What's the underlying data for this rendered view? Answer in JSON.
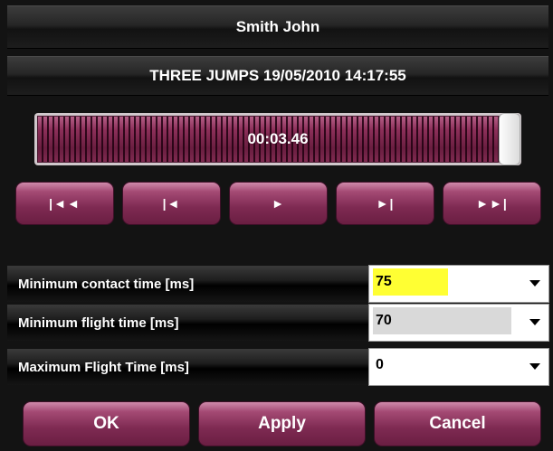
{
  "header": {
    "athlete_name": "Smith John"
  },
  "session": {
    "title": "THREE JUMPS 19/05/2010 14:17:55"
  },
  "timeline": {
    "current_time": "00:03.46",
    "progress": 1.0
  },
  "transport": {
    "first_label": "|◄◄",
    "prev_label": "|◄",
    "play_label": "►",
    "next_label": "►|",
    "last_label": "►►|"
  },
  "settings": {
    "min_contact": {
      "label": "Minimum contact time [ms]",
      "value": "75",
      "highlight": "#ffff33"
    },
    "min_flight": {
      "label": "Minimum flight time [ms]",
      "value": "70",
      "highlight": "#d9d9d9"
    },
    "max_flight": {
      "label": "Maximum Flight Time [ms]",
      "value": "0"
    }
  },
  "actions": {
    "ok_label": "OK",
    "apply_label": "Apply",
    "cancel_label": "Cancel"
  },
  "colors": {
    "accent": "#7e2a52",
    "background": "#131313"
  }
}
